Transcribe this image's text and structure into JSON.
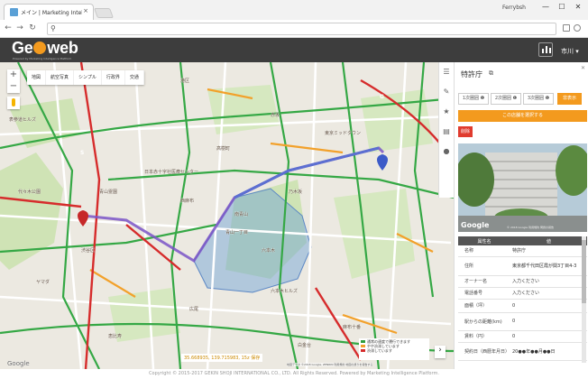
{
  "browser": {
    "tab_title": "メイン | Marketing Intellig",
    "tab_close": "×",
    "user": "Ferrybsh",
    "controls": [
      "—",
      "☐",
      "✕"
    ],
    "address": ""
  },
  "app": {
    "logo": {
      "left": "Ge",
      "right": "web"
    },
    "tagline": "Powered by Marketing Intelligence Platform",
    "user_menu": "市川 ▾"
  },
  "map": {
    "type_buttons": [
      "地図",
      "航空写真",
      "シンプル",
      "行政界",
      "交通"
    ],
    "zoom_in": "+",
    "zoom_out": "−",
    "labels": [
      "港区",
      "高樹町",
      "日本赤十字社医療センター",
      "南青山",
      "六本木ヒルズ",
      "麻布十番",
      "東京ミッドタウン",
      "表参道ヒルズ",
      "青山霊園",
      "代々木公園",
      "渋谷区",
      "恵比寿",
      "広尾",
      "白金台",
      "ヤマダ",
      "西麻布",
      "六本木",
      "赤坂",
      "青山一丁目",
      "乃木坂",
      "Google"
    ],
    "coords_text": "35.668935, 139.715983, 15z 保存",
    "legend": [
      {
        "label": "通常の速度で運行できます",
        "color": "#2e9e3c"
      },
      {
        "label": "やや渋滞しています",
        "color": "#f2a12b"
      },
      {
        "label": "渋滞しています",
        "color": "#d62c2c"
      }
    ],
    "attribution": "地図データ ©2018 Google, ZENRIN 利用規約 地図の誤りを報告する",
    "start_marker": "S",
    "goal_marker": "G"
  },
  "panel": {
    "title": "特許庁",
    "tabs": [
      "1次圏囲 ❶",
      "2次圏囲 ❶",
      "3次圏囲 ❶"
    ],
    "hide_button": "非表示",
    "select_button": "この店舗を選択する",
    "delete_button": "削除",
    "photo_footer": "© 2018 Google  利用規約  問題の報告",
    "table_headers": [
      "属性名",
      "値"
    ],
    "rows": [
      {
        "key": "名称",
        "value": "特許庁"
      },
      {
        "key": "住所",
        "value": "東京都千代田区霞が関3丁目4-3"
      },
      {
        "key": "オーナー名",
        "value": "入力ください"
      },
      {
        "key": "電話番号",
        "value": "入力ください"
      },
      {
        "key": "面積（坪）",
        "value": "0"
      },
      {
        "key": "駅からの距離(km)",
        "value": "0"
      },
      {
        "key": "賃料（円）",
        "value": "0"
      },
      {
        "key": "契約日（西暦年月日）",
        "value": "20●●年●●月●●日"
      }
    ]
  },
  "footer": "Copyright © 2015-2017 GEKIN SHOJI INTERNATIONAL CO., LTD. All Rights Reserved.  Powered by Marketing Intelligence Platform."
}
